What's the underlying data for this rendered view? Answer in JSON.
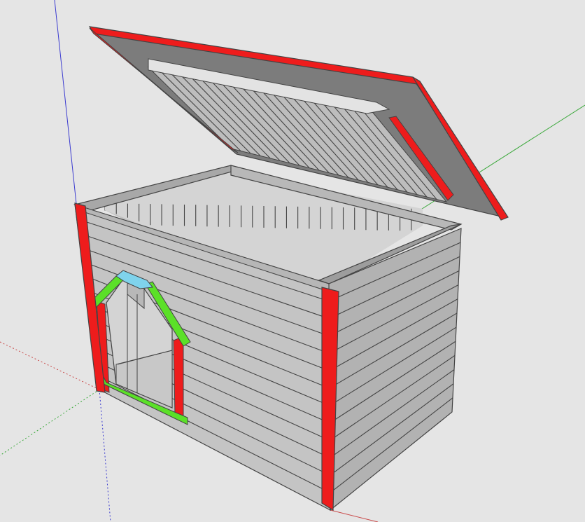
{
  "scene": {
    "subject": "dog-house-3d-model",
    "background_color": "#e5e5e5",
    "colors": {
      "wall_face": "#c4c4c4",
      "wall_side": "#b2b2b2",
      "interior_light": "#d4d4d4",
      "interior_dark": "#9d9d9d",
      "board_line": "#444444",
      "corner_trim": "#ee1c1c",
      "lid_trim": "#ee1c1c",
      "lid_panel": "#7c7c7c",
      "lid_boards": "#bdbdbd",
      "lid_cleat": "#e3e3e3",
      "door_frame_green": "#5be028",
      "door_lintel_cyan": "#7fd3ec",
      "axis_red": "#c94a4a",
      "axis_green": "#3aa83a",
      "axis_blue": "#3a3ad0"
    },
    "parts": [
      "front-wall",
      "right-wall",
      "open-top-interior",
      "hinged-lid",
      "door-opening"
    ]
  }
}
